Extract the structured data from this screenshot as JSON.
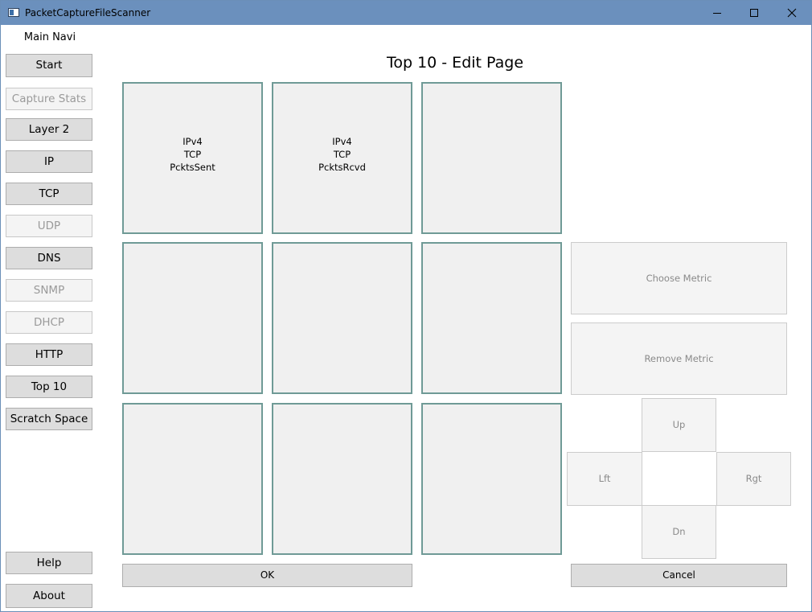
{
  "window": {
    "title": "PacketCaptureFileScanner"
  },
  "sidebar": {
    "title": "Main Navi",
    "items": [
      {
        "label": "Start",
        "enabled": true
      },
      {
        "label": "Capture Stats",
        "enabled": false
      },
      {
        "label": "Layer 2",
        "enabled": true
      },
      {
        "label": "IP",
        "enabled": true
      },
      {
        "label": "TCP",
        "enabled": true
      },
      {
        "label": "UDP",
        "enabled": false
      },
      {
        "label": "DNS",
        "enabled": true
      },
      {
        "label": "SNMP",
        "enabled": false
      },
      {
        "label": "DHCP",
        "enabled": false
      },
      {
        "label": "HTTP",
        "enabled": true
      },
      {
        "label": "Top 10",
        "enabled": true
      },
      {
        "label": "Scratch Space",
        "enabled": true
      }
    ],
    "help_label": "Help",
    "about_label": "About"
  },
  "main": {
    "title": "Top 10 - Edit Page",
    "grid": [
      {
        "lines": [
          "IPv4",
          "TCP",
          "PcktsSent"
        ]
      },
      {
        "lines": [
          "IPv4",
          "TCP",
          "PcktsRcvd"
        ]
      },
      {
        "lines": []
      },
      {
        "lines": []
      },
      {
        "lines": []
      },
      {
        "lines": []
      },
      {
        "lines": []
      },
      {
        "lines": []
      },
      {
        "lines": []
      }
    ],
    "choose_metric_label": "Choose Metric",
    "remove_metric_label": "Remove Metric",
    "up_label": "Up",
    "left_label": "Lft",
    "right_label": "Rgt",
    "down_label": "Dn",
    "ok_label": "OK",
    "cancel_label": "Cancel"
  }
}
